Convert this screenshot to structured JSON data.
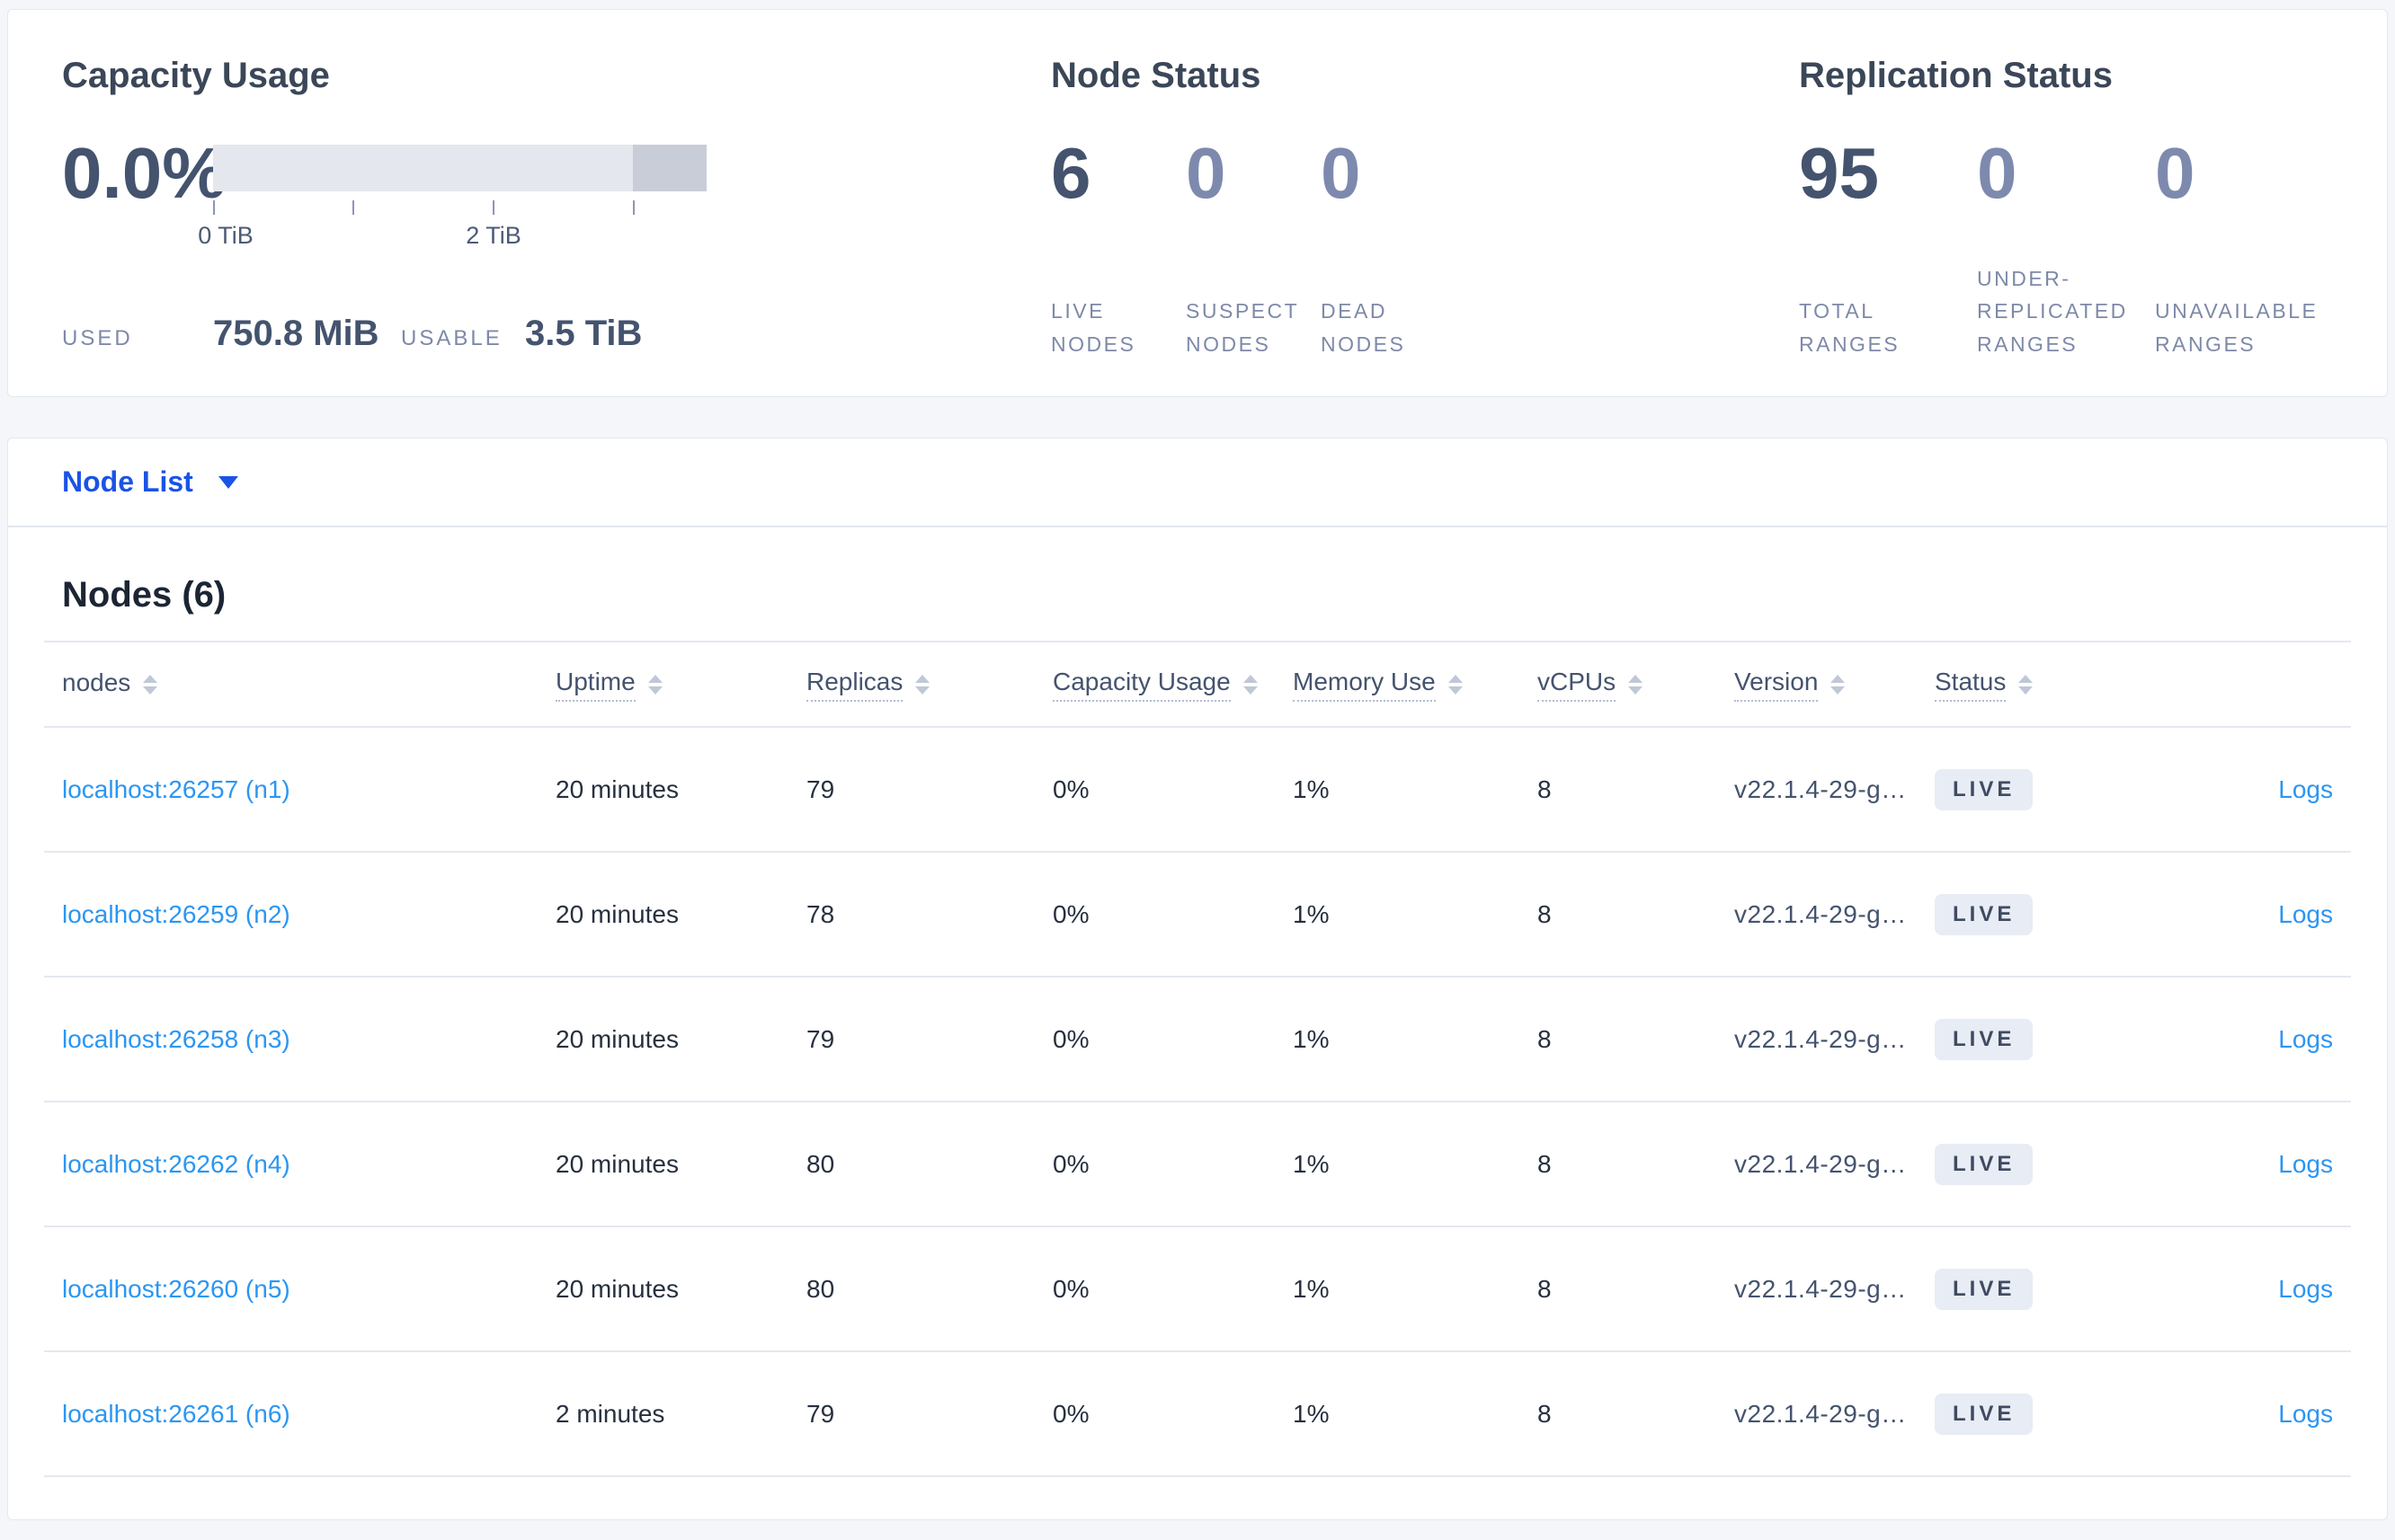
{
  "colors": {
    "page_bg": "#f4f6fa",
    "card_border": "#e3e8f0",
    "accent_blue": "#1a53e5",
    "link_blue": "#2b96f2",
    "text_dark": "#242d3d",
    "slate": "#44536e",
    "muted_label": "#7e89a8",
    "zero_value": "#7d8aae",
    "badge_bg": "#e8ecf4",
    "bar_light": "#e4e7ed",
    "bar_dark": "#c9cdd8",
    "divider": "#e4e8f0"
  },
  "overview": {
    "capacity": {
      "title": "Capacity Usage",
      "percent": "0.0%",
      "tick_labels": [
        "0 TiB",
        "2 TiB"
      ],
      "used_label": "USED",
      "used_value": "750.8 MiB",
      "usable_label": "USABLE",
      "usable_value": "3.5 TiB"
    },
    "node_status": {
      "title": "Node Status",
      "stats": [
        {
          "value": "6",
          "label": "LIVE NODES"
        },
        {
          "value": "0",
          "label": "SUSPECT NODES"
        },
        {
          "value": "0",
          "label": "DEAD NODES"
        }
      ]
    },
    "replication_status": {
      "title": "Replication Status",
      "stats": [
        {
          "value": "95",
          "label": "TOTAL RANGES"
        },
        {
          "value": "0",
          "label": "UNDER-REPLICATED RANGES"
        },
        {
          "value": "0",
          "label": "UNAVAILABLE RANGES"
        }
      ]
    }
  },
  "node_list": {
    "dropdown_label": "Node List"
  },
  "table": {
    "title": "Nodes (6)",
    "columns": [
      "nodes",
      "Uptime",
      "Replicas",
      "Capacity Usage",
      "Memory Use",
      "vCPUs",
      "Version",
      "Status"
    ],
    "rows": [
      {
        "node": "localhost:26257 (n1)",
        "uptime": "20 minutes",
        "replicas": "79",
        "capacity": "0%",
        "memory": "1%",
        "vcpus": "8",
        "version": "v22.1.4-29-g…",
        "status": "LIVE",
        "logs": "Logs"
      },
      {
        "node": "localhost:26259 (n2)",
        "uptime": "20 minutes",
        "replicas": "78",
        "capacity": "0%",
        "memory": "1%",
        "vcpus": "8",
        "version": "v22.1.4-29-g…",
        "status": "LIVE",
        "logs": "Logs"
      },
      {
        "node": "localhost:26258 (n3)",
        "uptime": "20 minutes",
        "replicas": "79",
        "capacity": "0%",
        "memory": "1%",
        "vcpus": "8",
        "version": "v22.1.4-29-g…",
        "status": "LIVE",
        "logs": "Logs"
      },
      {
        "node": "localhost:26262 (n4)",
        "uptime": "20 minutes",
        "replicas": "80",
        "capacity": "0%",
        "memory": "1%",
        "vcpus": "8",
        "version": "v22.1.4-29-g…",
        "status": "LIVE",
        "logs": "Logs"
      },
      {
        "node": "localhost:26260 (n5)",
        "uptime": "20 minutes",
        "replicas": "80",
        "capacity": "0%",
        "memory": "1%",
        "vcpus": "8",
        "version": "v22.1.4-29-g…",
        "status": "LIVE",
        "logs": "Logs"
      },
      {
        "node": "localhost:26261 (n6)",
        "uptime": "2 minutes",
        "replicas": "79",
        "capacity": "0%",
        "memory": "1%",
        "vcpus": "8",
        "version": "v22.1.4-29-g…",
        "status": "LIVE",
        "logs": "Logs"
      }
    ]
  }
}
